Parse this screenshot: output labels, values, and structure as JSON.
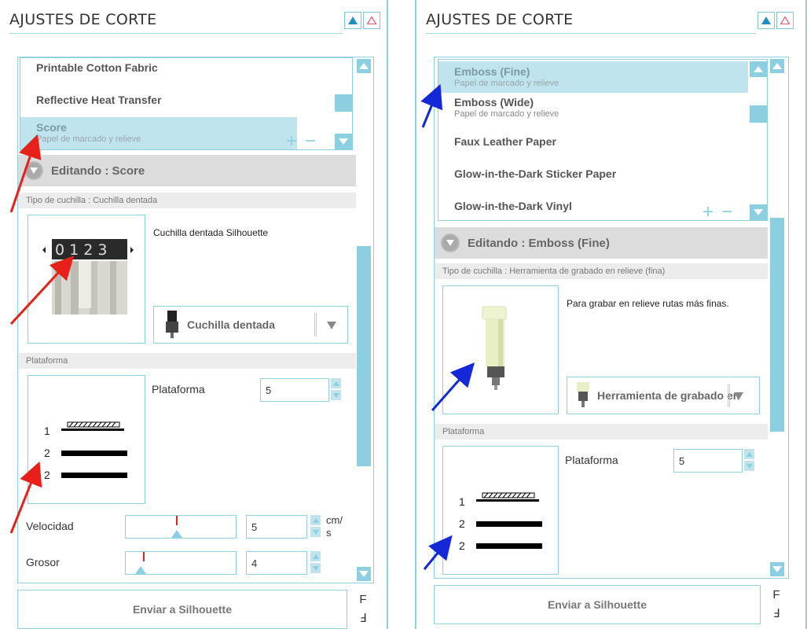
{
  "left": {
    "title": "AJUSTES DE CORTE",
    "list": [
      {
        "name": "Printable Cotton Fabric",
        "sub": ""
      },
      {
        "name": "Reflective Heat Transfer",
        "sub": ""
      },
      {
        "name": "Score",
        "sub": "Papel de marcado y relieve",
        "selected": true
      }
    ],
    "editing_label": "Editando : Score",
    "blade_type_label": "Tipo de cuchilla : Cuchilla dentada",
    "blade_description": "Cuchilla dentada Silhouette",
    "blade_digits": "0 1 2 3",
    "blade_dropdown": "Cuchilla dentada",
    "platform_section": "Plataforma",
    "platform_label": "Plataforma",
    "platform_value": "5",
    "mat_numbers": [
      "1",
      "2",
      "2"
    ],
    "speed_label": "Velocidad",
    "speed_value": "5",
    "speed_unit_top": "cm/",
    "speed_unit_bottom": "s",
    "thickness_label": "Grosor",
    "thickness_value": "4",
    "send_button": "Enviar a Silhouette",
    "f_top": "F",
    "f_bottom": "Ⅎ"
  },
  "right": {
    "title": "AJUSTES DE CORTE",
    "list": [
      {
        "name": "Emboss (Fine)",
        "sub": "Papel de marcado y relieve",
        "selected": true
      },
      {
        "name": "Emboss (Wide)",
        "sub": "Papel de marcado y relieve"
      },
      {
        "name": "Faux Leather Paper",
        "sub": ""
      },
      {
        "name": "Glow-in-the-Dark Sticker Paper",
        "sub": ""
      },
      {
        "name": "Glow-in-the-Dark Vinyl",
        "sub": ""
      }
    ],
    "editing_label": "Editando : Emboss (Fine)",
    "blade_type_label": "Tipo de cuchilla : Herramienta de grabado en relieve (fina)",
    "blade_description": "Para grabar en relieve rutas más finas.",
    "blade_dropdown": "Herramienta de grabado en",
    "platform_section": "Plataforma",
    "platform_label": "Plataforma",
    "platform_value": "5",
    "mat_numbers": [
      "1",
      "2",
      "2"
    ],
    "send_button": "Enviar a Silhouette",
    "f_top": "F",
    "f_bottom": "Ⅎ"
  },
  "colors": {
    "accent": "#8ccfe0",
    "selection": "#bfe4ee",
    "arrow_red": "#e8201a",
    "arrow_blue": "#1428d8"
  }
}
